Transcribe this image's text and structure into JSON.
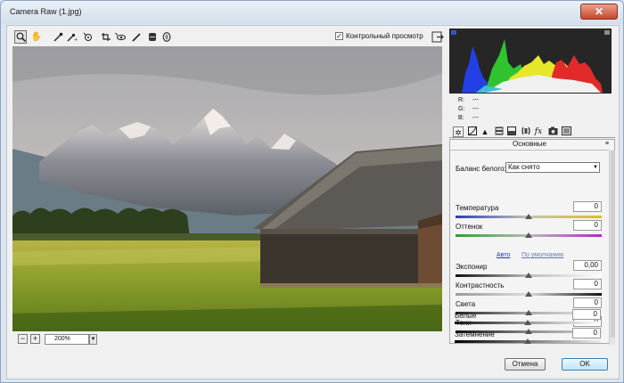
{
  "window": {
    "title": "Camera Raw (1.jpg)"
  },
  "toolbar": {
    "preview_label": "Контрольный просмотр",
    "preview_checked": true
  },
  "zoom": {
    "value": "200%"
  },
  "histogram": {
    "r_label": "R:",
    "g_label": "G:",
    "b_label": "B:",
    "r_value": "---",
    "g_value": "---",
    "b_value": "---"
  },
  "panel": {
    "title": "Основные",
    "wb_label": "Баланс белого:",
    "wb_value": "Как снято",
    "auto_link": "Авто",
    "default_link": "По умолчанию",
    "sliders": [
      {
        "label": "Температура",
        "value": "0",
        "level": 0.5
      },
      {
        "label": "Оттенок",
        "value": "0",
        "level": 0.5
      },
      {
        "label": "Экспонир",
        "value": "0,00",
        "level": 0.5
      },
      {
        "label": "Контрастность",
        "value": "0",
        "level": 0.5
      },
      {
        "label": "Света",
        "value": "0",
        "level": 0.5
      },
      {
        "label": "Тени",
        "value": "0",
        "level": 0.5
      },
      {
        "label": "Белые",
        "value": "0",
        "level": 0.5
      },
      {
        "label": "Затемнение",
        "value": "0",
        "level": 0.5
      }
    ]
  },
  "buttons": {
    "cancel": "Отмена",
    "ok": "OK"
  }
}
